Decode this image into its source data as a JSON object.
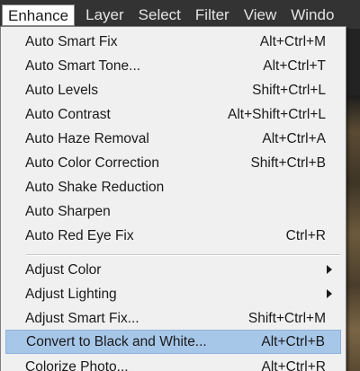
{
  "menubar": {
    "items": [
      {
        "label": "Enhance"
      },
      {
        "label": "Layer"
      },
      {
        "label": "Select"
      },
      {
        "label": "Filter"
      },
      {
        "label": "View"
      },
      {
        "label": "Windo"
      }
    ]
  },
  "enhance_menu": {
    "group1": [
      {
        "label": "Auto Smart Fix",
        "shortcut": "Alt+Ctrl+M"
      },
      {
        "label": "Auto Smart Tone...",
        "shortcut": "Alt+Ctrl+T"
      },
      {
        "label": "Auto Levels",
        "shortcut": "Shift+Ctrl+L"
      },
      {
        "label": "Auto Contrast",
        "shortcut": "Alt+Shift+Ctrl+L"
      },
      {
        "label": "Auto Haze Removal",
        "shortcut": "Alt+Ctrl+A"
      },
      {
        "label": "Auto Color Correction",
        "shortcut": "Shift+Ctrl+B"
      },
      {
        "label": "Auto Shake Reduction",
        "shortcut": ""
      },
      {
        "label": "Auto Sharpen",
        "shortcut": ""
      },
      {
        "label": "Auto Red Eye Fix",
        "shortcut": "Ctrl+R"
      }
    ],
    "group2": [
      {
        "label": "Adjust Color",
        "shortcut": ""
      },
      {
        "label": "Adjust Lighting",
        "shortcut": ""
      },
      {
        "label": "Adjust Smart Fix...",
        "shortcut": "Shift+Ctrl+M"
      },
      {
        "label": "Convert to Black and White...",
        "shortcut": "Alt+Ctrl+B"
      },
      {
        "label": "Colorize Photo...",
        "shortcut": "Alt+Ctrl+R"
      }
    ]
  },
  "colors": {
    "highlight": "#a7c7e9",
    "menu_bg": "#f0f0f0",
    "menubar_bg": "#333333"
  }
}
